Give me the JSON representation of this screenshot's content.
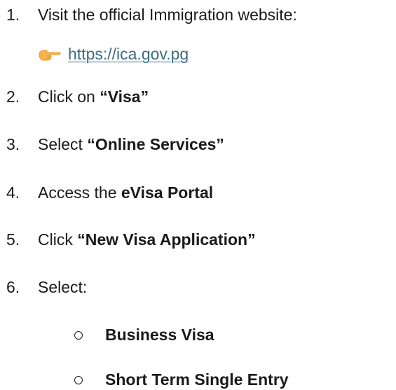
{
  "steps": [
    {
      "number": "1.",
      "prefix": "Visit the official Immigration website:",
      "bold": "",
      "suffix": ""
    },
    {
      "number": "2.",
      "prefix": "Click on ",
      "bold": "“Visa”",
      "suffix": ""
    },
    {
      "number": "3.",
      "prefix": "Select ",
      "bold": "“Online Services”",
      "suffix": ""
    },
    {
      "number": "4.",
      "prefix": "Access the ",
      "bold": "eVisa Portal",
      "suffix": ""
    },
    {
      "number": "5.",
      "prefix": "Click ",
      "bold": "“New Visa Application”",
      "suffix": ""
    },
    {
      "number": "6.",
      "prefix": "Select:",
      "bold": "",
      "suffix": ""
    }
  ],
  "website": {
    "icon": "pointing-hand-icon",
    "url": "https://ica.gov.pg",
    "link_color": "#3b6e80"
  },
  "sub_options": [
    {
      "label": "Business Visa",
      "icon": "hollow-circle-bullet"
    },
    {
      "label": "Short Term Single Entry",
      "icon": "hollow-circle-bullet"
    }
  ]
}
